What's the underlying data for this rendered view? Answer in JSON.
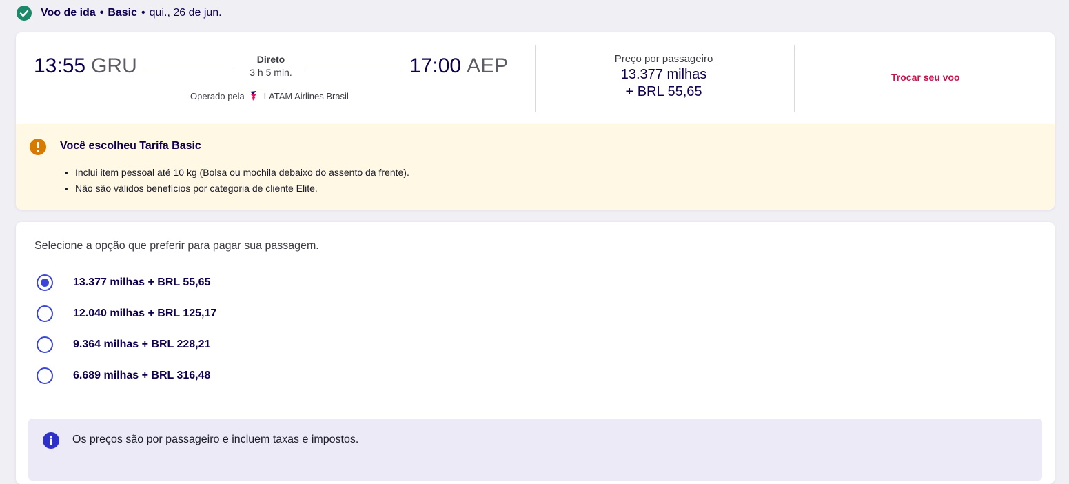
{
  "section": {
    "title": "Voo de ida",
    "fare": "Basic",
    "date": "qui., 26 de jun."
  },
  "flight": {
    "departure_time": "13:55",
    "departure_code": "GRU",
    "arrival_time": "17:00",
    "arrival_code": "AEP",
    "stop_type": "Direto",
    "duration": "3 h 5 min.",
    "operated_by_label": "Operado pela",
    "airline": "LATAM Airlines Brasil",
    "price_caption": "Preço por passageiro",
    "price_miles": "13.377 milhas",
    "price_brl": "+ BRL 55,65",
    "change_flight_label": "Trocar seu voo"
  },
  "warning": {
    "title": "Você escolheu Tarifa Basic",
    "items": [
      "Inclui item pessoal até 10 kg (Bolsa ou mochila debaixo do assento da frente).",
      "Não são válidos benefícios por categoria de cliente Elite."
    ]
  },
  "payment": {
    "prompt": "Selecione a opção que preferir para pagar sua passagem.",
    "options": [
      {
        "label": "13.377 milhas + BRL 55,65",
        "selected": true
      },
      {
        "label": "12.040 milhas + BRL 125,17",
        "selected": false
      },
      {
        "label": "9.364 milhas + BRL 228,21",
        "selected": false
      },
      {
        "label": "6.689 milhas + BRL 316,48",
        "selected": false
      }
    ],
    "info": "Os preços são por passageiro e incluem taxas e impostos."
  },
  "colors": {
    "accent": "#3b45d6",
    "link": "#c9134b",
    "success": "#1b8a6b",
    "warning": "#d97a00",
    "text_primary": "#10004f"
  },
  "icons": {
    "section_status": "check-circle-icon",
    "airline": "latam-logo-icon",
    "warning": "exclamation-circle-icon",
    "info": "info-circle-icon"
  }
}
